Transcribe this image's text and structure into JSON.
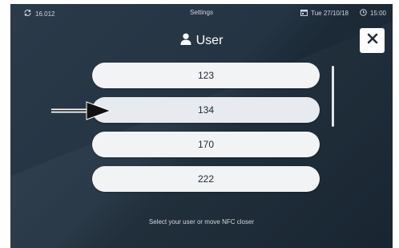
{
  "status_bar": {
    "left_value": "16.012",
    "center_title": "Settings",
    "date": "Tue 27/10/18",
    "time": "15:00"
  },
  "header": {
    "title": "User",
    "icon": "user-icon"
  },
  "close": {
    "icon": "close-icon"
  },
  "users": [
    {
      "label": "123"
    },
    {
      "label": "134"
    },
    {
      "label": "170"
    },
    {
      "label": "222"
    }
  ],
  "hint": {
    "text": "Select your user or move NFC closer"
  },
  "colors": {
    "background": "#243443",
    "pill": "#f1f3f5",
    "pill_text": "#1f2a36",
    "text_light": "#ffffff"
  }
}
